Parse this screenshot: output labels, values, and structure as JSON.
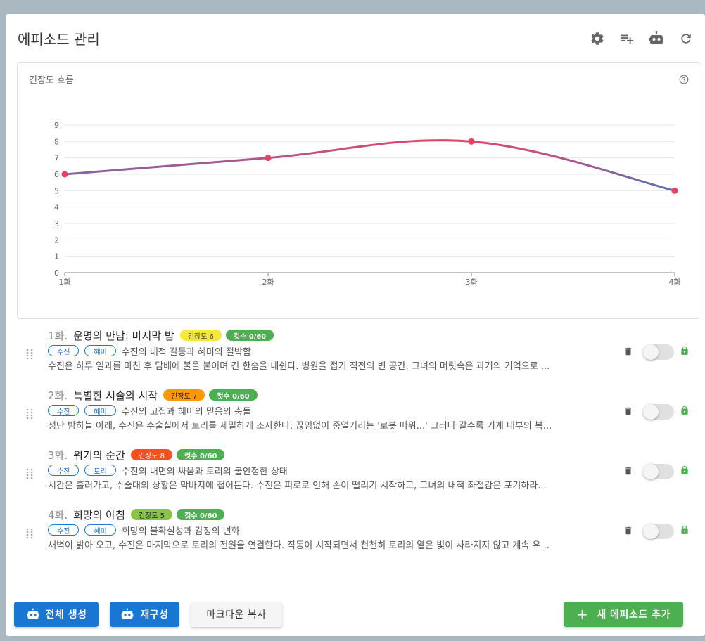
{
  "header": {
    "title": "에피소드 관리"
  },
  "icons": {
    "settings": "gear-icon",
    "add_list": "playlist-add-icon",
    "robot": "robot-icon",
    "refresh": "refresh-icon"
  },
  "chart": {
    "title": "긴장도 흐름"
  },
  "chart_data": {
    "type": "line",
    "categories": [
      "1화",
      "2화",
      "3화",
      "4화"
    ],
    "values": [
      6,
      7,
      8,
      5
    ],
    "yticks": [
      "0",
      "1",
      "2",
      "3",
      "4",
      "5",
      "6",
      "7",
      "8",
      "9"
    ],
    "ylim": [
      0,
      9
    ],
    "grid": true,
    "colors": {
      "low": "#2f7fd6",
      "high": "#e0466a",
      "point": "#ef3f5f"
    }
  },
  "episodes": [
    {
      "num": "1화.",
      "title": "운명의 만남: 마지막 밤",
      "tension": "긴장도 6",
      "tension_color": "#f5e93a",
      "tension_text_color": "#444",
      "cuts": "컷수 0/60",
      "chips": [
        "수진",
        "혜미"
      ],
      "desc": "수진의 내적 갈등과 혜미의 절박함",
      "summary": "수진은 하루 일과를 마친 후 담배에 불을 붙이며 긴 한숨을 내쉰다. 병원을 접기 직전의 빈 공간, 그녀의 머릿속은 과거의 기억으로 ..."
    },
    {
      "num": "2화.",
      "title": "특별한 시술의 시작",
      "tension": "긴장도 7",
      "tension_color": "#ff9800",
      "tension_text_color": "#222",
      "cuts": "컷수 0/60",
      "chips": [
        "수진",
        "혜미"
      ],
      "desc": "수진의 고집과 혜미의 믿음의 충돌",
      "summary": "성난 밤하늘 아래, 수진은 수술실에서 토리를 세밀하게 조사한다. 끊임없이 중얼거리는 '로봇 따위...' 그러나 갈수록 기계 내부의 복..."
    },
    {
      "num": "3화.",
      "title": "위기의 순간",
      "tension": "긴장도 8",
      "tension_color": "#f4511e",
      "tension_text_color": "#fff",
      "cuts": "컷수 0/60",
      "chips": [
        "수진",
        "토리"
      ],
      "desc": "수진의 내면의 싸움과 토리의 불안정한 상태",
      "summary": "시간은 흘러가고, 수술대의 상황은 막바지에 접어든다. 수진은 피로로 인해 손이 떨리기 시작하고, 그녀의 내적 좌절감은 포기하라..."
    },
    {
      "num": "4화.",
      "title": "희망의 아침",
      "tension": "긴장도 5",
      "tension_color": "#8bc34a",
      "tension_text_color": "#222",
      "cuts": "컷수 0/60",
      "chips": [
        "수진",
        "혜미"
      ],
      "desc": "희망의 불확실성과 감정의 변화",
      "summary": "새벽이 밝아 오고, 수진은 마지막으로 토리의 전원을 연결한다. 작동이 시작되면서 천천히 토리의 옅은 빛이 사라지지 않고 계속 유..."
    }
  ],
  "footer": {
    "generate_all": "전체 생성",
    "restructure": "재구성",
    "copy_markdown": "마크다운 복사",
    "add_episode": "새 에피소드 추가"
  }
}
